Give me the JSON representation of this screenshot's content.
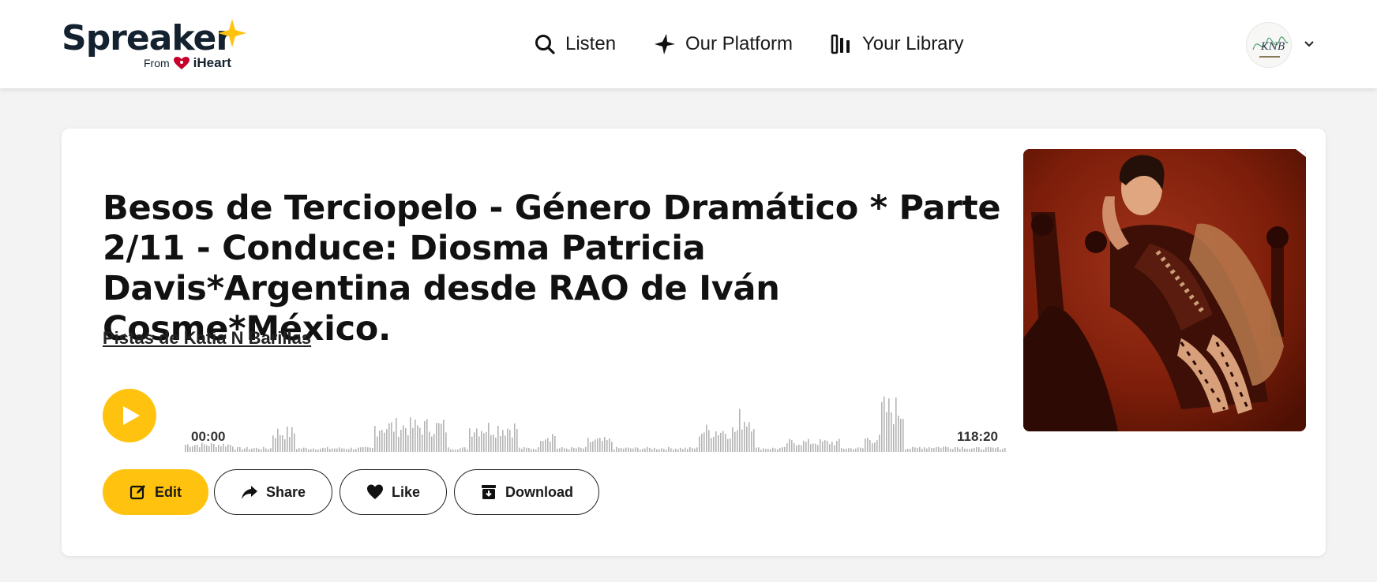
{
  "header": {
    "logo": {
      "wordmark": "Spreaker",
      "from": "From",
      "brand": "iHeart"
    },
    "nav": [
      {
        "label": "Listen",
        "icon": "search-icon"
      },
      {
        "label": "Our Platform",
        "icon": "star-icon"
      },
      {
        "label": "Your Library",
        "icon": "library-icon"
      }
    ],
    "avatar": {
      "text": "KNB"
    }
  },
  "episode": {
    "title": "Besos de Terciopelo - Género Dramático * Parte 2/11 - Conduce: Diosma Patricia Davis*Argentina desde RAO de Iván Cosme*México.",
    "author": "Pistas de Katia N Barillas",
    "time_start": "00:00",
    "time_end": "118:20"
  },
  "actions": {
    "edit": "Edit",
    "share": "Share",
    "like": "Like",
    "download": "Download"
  },
  "colors": {
    "accent": "#ffc20e",
    "text": "#111111",
    "waveform": "#b3b3b3",
    "background": "#f3f3f3"
  }
}
